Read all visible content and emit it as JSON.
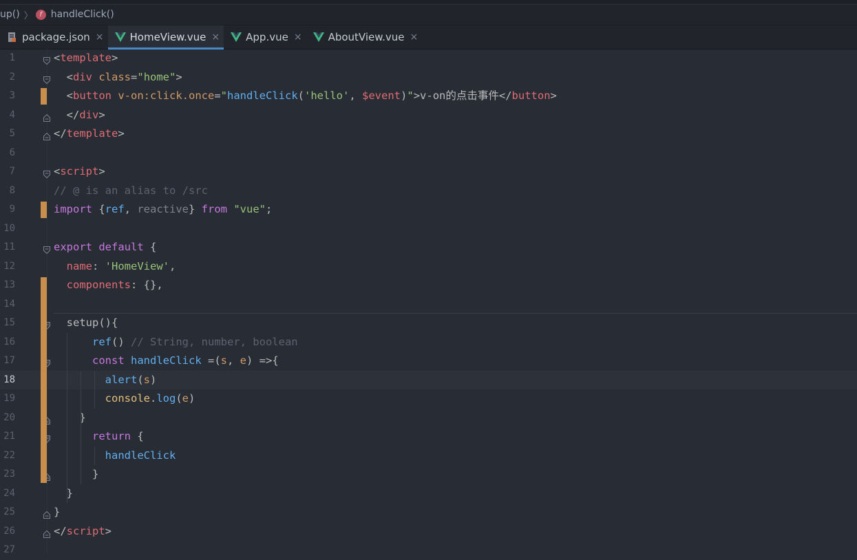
{
  "breadcrumb": {
    "parent": "up()",
    "current": "handleClick()",
    "fn_icon_letter": "f"
  },
  "tabs": [
    {
      "label": "package.json",
      "icon": "json-file-icon",
      "active": false
    },
    {
      "label": "HomeView.vue",
      "icon": "vue-file-icon",
      "active": true
    },
    {
      "label": "App.vue",
      "icon": "vue-file-icon",
      "active": false
    },
    {
      "label": "AboutView.vue",
      "icon": "vue-file-icon",
      "active": false
    }
  ],
  "tab_close_glyph": "×",
  "editor": {
    "current_line": 18,
    "line_numbers": [
      "1",
      "2",
      "3",
      "4",
      "5",
      "6",
      "7",
      "8",
      "9",
      "10",
      "11",
      "12",
      "13",
      "14",
      "15",
      "16",
      "17",
      "18",
      "19",
      "20",
      "21",
      "22",
      "23",
      "24",
      "25",
      "26",
      "27"
    ],
    "lines": [
      [
        [
          "t-punc",
          "<"
        ],
        [
          "t-tag",
          "template"
        ],
        [
          "t-punc",
          ">"
        ]
      ],
      [
        [
          "t-plain",
          "  "
        ],
        [
          "t-punc",
          "<"
        ],
        [
          "t-tag",
          "div "
        ],
        [
          "t-attr",
          "class"
        ],
        [
          "t-punc",
          "="
        ],
        [
          "t-str",
          "\"home\""
        ],
        [
          "t-punc",
          ">"
        ]
      ],
      [
        [
          "t-plain",
          "  "
        ],
        [
          "t-punc",
          "<"
        ],
        [
          "t-tag",
          "button "
        ],
        [
          "t-attr",
          "v-on:click.once"
        ],
        [
          "t-punc",
          "="
        ],
        [
          "t-str",
          "\""
        ],
        [
          "t-fn",
          "handleClick"
        ],
        [
          "t-punc",
          "("
        ],
        [
          "t-str",
          "'hello'"
        ],
        [
          "t-punc",
          ", "
        ],
        [
          "t-ev",
          "$event"
        ],
        [
          "t-punc",
          ")"
        ],
        [
          "t-str",
          "\""
        ],
        [
          "t-punc",
          ">"
        ],
        [
          "t-plain",
          "v-on的点击事件"
        ],
        [
          "t-punc",
          "</"
        ],
        [
          "t-tag",
          "button"
        ],
        [
          "t-punc",
          ">"
        ]
      ],
      [
        [
          "t-plain",
          "  "
        ],
        [
          "t-punc",
          "</"
        ],
        [
          "t-tag",
          "div"
        ],
        [
          "t-punc",
          ">"
        ]
      ],
      [
        [
          "t-punc",
          "</"
        ],
        [
          "t-tag",
          "template"
        ],
        [
          "t-punc",
          ">"
        ]
      ],
      [],
      [
        [
          "t-punc",
          "<"
        ],
        [
          "t-tag",
          "script"
        ],
        [
          "t-punc",
          ">"
        ]
      ],
      [
        [
          "t-cmt",
          "// @ is an alias to /src"
        ]
      ],
      [
        [
          "t-kw",
          "import "
        ],
        [
          "t-punc",
          "{"
        ],
        [
          "t-fn",
          "ref"
        ],
        [
          "t-punc",
          ", "
        ],
        [
          "t-dim",
          "reactive"
        ],
        [
          "t-punc",
          "} "
        ],
        [
          "t-kw",
          "from "
        ],
        [
          "t-str",
          "\"vue\""
        ],
        [
          "t-punc",
          ";"
        ]
      ],
      [],
      [
        [
          "t-kw",
          "export default "
        ],
        [
          "t-punc",
          "{"
        ]
      ],
      [
        [
          "t-plain",
          "  "
        ],
        [
          "t-prop",
          "name"
        ],
        [
          "t-punc",
          ": "
        ],
        [
          "t-str",
          "'HomeView'"
        ],
        [
          "t-punc",
          ","
        ]
      ],
      [
        [
          "t-plain",
          "  "
        ],
        [
          "t-prop",
          "components"
        ],
        [
          "t-punc",
          ": {},"
        ]
      ],
      [],
      [
        [
          "t-plain",
          "  "
        ],
        [
          "t-plain",
          "setup(){"
        ]
      ],
      [
        [
          "t-plain",
          "      "
        ],
        [
          "t-fn",
          "ref"
        ],
        [
          "t-punc",
          "() "
        ],
        [
          "t-cmt",
          "// String, number, boolean"
        ]
      ],
      [
        [
          "t-plain",
          "      "
        ],
        [
          "t-kw",
          "const "
        ],
        [
          "t-fn",
          "handleClick "
        ],
        [
          "t-punc",
          "=("
        ],
        [
          "t-param",
          "s"
        ],
        [
          "t-punc",
          ", "
        ],
        [
          "t-param",
          "e"
        ],
        [
          "t-punc",
          ") =>{"
        ]
      ],
      [
        [
          "t-plain",
          "        "
        ],
        [
          "t-fn",
          "alert"
        ],
        [
          "t-punc",
          "("
        ],
        [
          "t-param",
          "s"
        ],
        [
          "t-punc",
          ")"
        ]
      ],
      [
        [
          "t-plain",
          "        "
        ],
        [
          "t-var",
          "console"
        ],
        [
          "t-punc",
          "."
        ],
        [
          "t-fn",
          "log"
        ],
        [
          "t-punc",
          "("
        ],
        [
          "t-param",
          "e"
        ],
        [
          "t-punc",
          ")"
        ]
      ],
      [
        [
          "t-plain",
          "    "
        ],
        [
          "t-punc",
          "}"
        ]
      ],
      [
        [
          "t-plain",
          "      "
        ],
        [
          "t-kw",
          "return "
        ],
        [
          "t-punc",
          "{"
        ]
      ],
      [
        [
          "t-plain",
          "        "
        ],
        [
          "t-fn",
          "handleClick"
        ]
      ],
      [
        [
          "t-plain",
          "      "
        ],
        [
          "t-punc",
          "}"
        ]
      ],
      [
        [
          "t-plain",
          "  "
        ],
        [
          "t-punc",
          "}"
        ]
      ],
      [
        [
          "t-punc",
          "}"
        ]
      ],
      [
        [
          "t-punc",
          "</"
        ],
        [
          "t-tag",
          "script"
        ],
        [
          "t-punc",
          ">"
        ]
      ],
      []
    ]
  },
  "colors": {
    "background": "#282c34",
    "change_marker": "#c98e4c",
    "active_tab_underline": "#4a88c7",
    "vue_logo": "#41b883"
  }
}
